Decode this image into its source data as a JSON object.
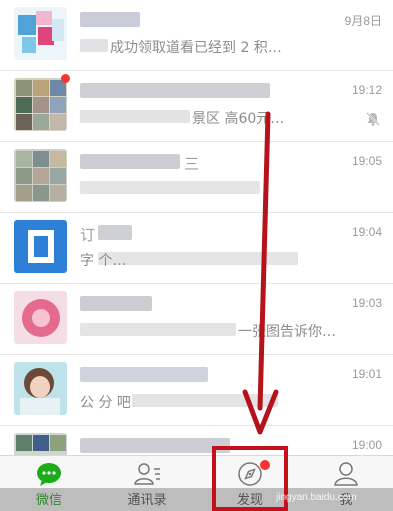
{
  "chats": [
    {
      "name": "",
      "preview": "成功领取道看已经到 2 积…",
      "time": "9月8日",
      "muted": false,
      "unread": false
    },
    {
      "name": "",
      "preview": "景区 高60元…",
      "time": "19:12",
      "muted": true,
      "unread": true
    },
    {
      "name": "三",
      "preview": "",
      "time": "19:05",
      "muted": false,
      "unread": false
    },
    {
      "name": "订",
      "preview": "字 个…",
      "time": "19:04",
      "muted": false,
      "unread": false
    },
    {
      "name": "",
      "preview": "一张图告诉你…",
      "time": "19:03",
      "muted": false,
      "unread": false
    },
    {
      "name": "",
      "preview": "公 分 吧…",
      "time": "19:01",
      "muted": false,
      "unread": false
    },
    {
      "name": "",
      "preview": "",
      "time": "19:00",
      "muted": false,
      "unread": false
    }
  ],
  "tabs": [
    {
      "label": "微信",
      "icon": "chat-bubble-icon",
      "active": true
    },
    {
      "label": "通讯录",
      "icon": "contacts-icon",
      "active": false
    },
    {
      "label": "发现",
      "icon": "compass-icon",
      "active": false,
      "dot": true
    },
    {
      "label": "我",
      "icon": "person-icon",
      "active": false
    }
  ],
  "watermark": "jingyan.baidu.com",
  "colors": {
    "accent": "#1aad19",
    "annotation": "#c4101a",
    "badge": "#f43530"
  }
}
